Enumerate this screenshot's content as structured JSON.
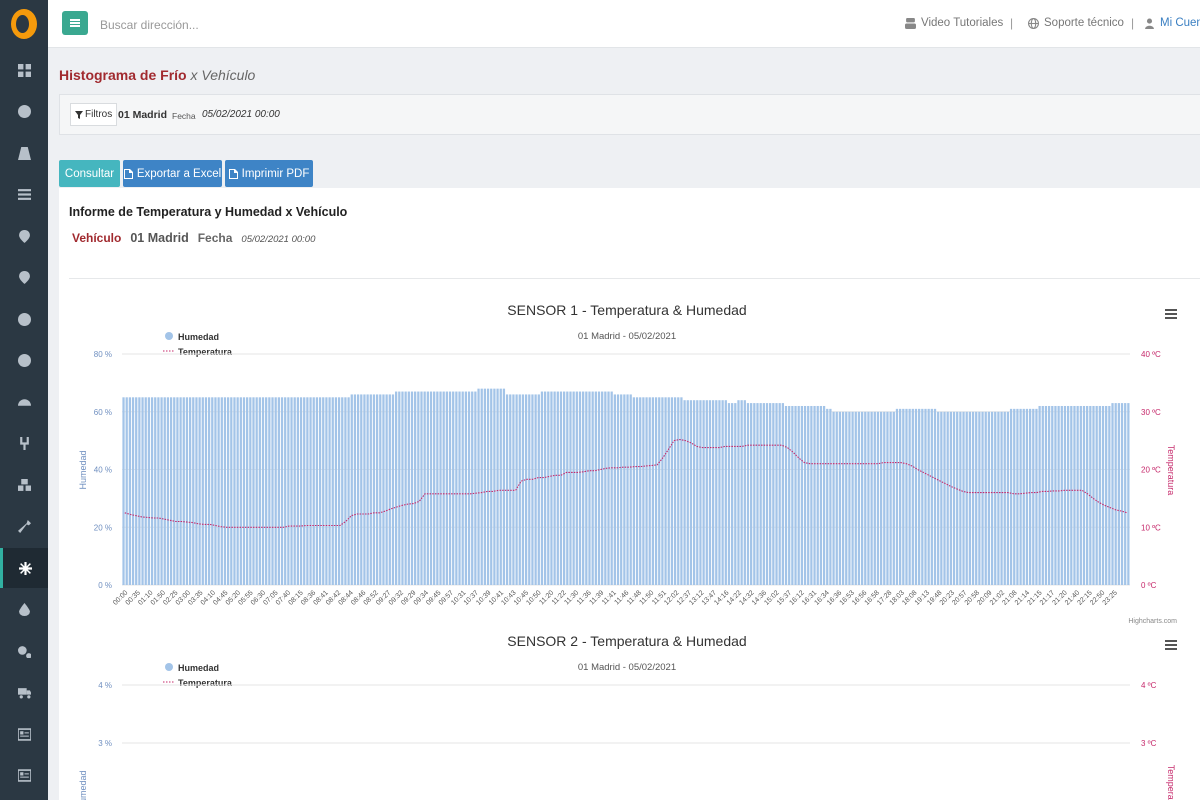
{
  "topbar": {
    "search_placeholder": "Buscar dirección...",
    "links": [
      {
        "label": "Video Tutoriales",
        "icon": "youtube-icon"
      },
      {
        "label": "Soporte técnico",
        "icon": "globe-icon"
      },
      {
        "label": "Mi Cuenta",
        "icon": "user-icon"
      }
    ],
    "separator": "|"
  },
  "sidebar": {
    "items": [
      {
        "name": "dashboard",
        "icon": "grid-icon"
      },
      {
        "name": "globe",
        "icon": "globe-icon"
      },
      {
        "name": "road",
        "icon": "road-icon"
      },
      {
        "name": "list",
        "icon": "list-icon"
      },
      {
        "name": "location",
        "icon": "map-pin-icon"
      },
      {
        "name": "location-2",
        "icon": "map-pin-icon"
      },
      {
        "name": "target",
        "icon": "target-icon"
      },
      {
        "name": "alert",
        "icon": "alert-icon"
      },
      {
        "name": "speed",
        "icon": "dashboard-icon"
      },
      {
        "name": "fork",
        "icon": "fork-icon"
      },
      {
        "name": "cubes",
        "icon": "cubes-icon"
      },
      {
        "name": "wrench",
        "icon": "wrench-icon"
      },
      {
        "name": "snowflake",
        "icon": "snowflake-icon",
        "active": true
      },
      {
        "name": "drop",
        "icon": "drop-icon"
      },
      {
        "name": "cogs",
        "icon": "cogs-icon"
      },
      {
        "name": "truck",
        "icon": "truck-icon"
      },
      {
        "name": "card",
        "icon": "id-card-icon"
      },
      {
        "name": "card-2",
        "icon": "id-card-icon"
      }
    ],
    "accent": "#31b0a1"
  },
  "page": {
    "title": "Histograma de Frío",
    "title_sub": "x Vehículo"
  },
  "filters": {
    "button_label": "Filtros",
    "vehicle": "01 Madrid",
    "date_label": "Fecha",
    "date": "05/02/2021 00:00"
  },
  "actions": {
    "consultar": "Consultar",
    "excel": "Exportar a Excel",
    "pdf": "Imprimir PDF"
  },
  "report": {
    "title": "Informe de Temperatura y Humedad x Vehículo",
    "vehicle_label": "Vehículo",
    "vehicle": "01 Madrid",
    "date_label": "Fecha",
    "date": "05/02/2021 00:00"
  },
  "chart_data": [
    {
      "type": "bar",
      "title": "SENSOR 1 - Temperatura & Humedad",
      "subtitle": "01 Madrid - 05/02/2021",
      "credits": "Highcharts.com",
      "legend_position": "top-left",
      "colors": {
        "humedad": "#a3c4e8",
        "temperatura": "#c6296b"
      },
      "ylabel_left": "Humedad",
      "ylabel_right": "Temperatura",
      "ylim_left": [
        0,
        80
      ],
      "ylim_right": [
        0,
        40
      ],
      "yticks_left": [
        "0 %",
        "20 %",
        "40 %",
        "60 %",
        "80 %"
      ],
      "yticks_right": [
        "0 ºC",
        "10 ºC",
        "20 ºC",
        "30 ºC",
        "40 ºC"
      ],
      "xtick_labels": [
        "00:00",
        "00:35",
        "01:10",
        "01:50",
        "02:25",
        "03:00",
        "03:35",
        "04:10",
        "04:45",
        "05:20",
        "05:55",
        "06:30",
        "07:05",
        "07:40",
        "08:15",
        "08:36",
        "08:41",
        "08:42",
        "08:44",
        "08:46",
        "08:52",
        "09:27",
        "09:32",
        "09:29",
        "09:34",
        "09:45",
        "09:57",
        "10:31",
        "10:37",
        "10:39",
        "10:41",
        "10:43",
        "10:45",
        "10:50",
        "11:20",
        "11:22",
        "11:30",
        "11:36",
        "11:39",
        "11:41",
        "11:46",
        "11:48",
        "11:50",
        "11:51",
        "12:02",
        "12:37",
        "13:12",
        "13:47",
        "14:16",
        "14:22",
        "14:32",
        "14:36",
        "15:02",
        "15:37",
        "16:12",
        "16:31",
        "16:34",
        "16:36",
        "16:53",
        "16:56",
        "16:58",
        "17:28",
        "18:03",
        "18:08",
        "19:13",
        "19:48",
        "20:23",
        "20:57",
        "20:58",
        "20:09",
        "21:02",
        "21:08",
        "21:14",
        "21:15",
        "21:17",
        "21:20",
        "21:40",
        "22:15",
        "22:50",
        "23:25"
      ],
      "series": [
        {
          "name": "Humedad",
          "type": "bar",
          "axis": "left",
          "values": [
            65,
            65,
            65,
            65,
            65,
            65,
            65,
            65,
            65,
            65,
            65,
            65,
            65,
            65,
            65,
            65,
            65,
            65,
            65,
            65,
            65,
            65,
            65,
            65,
            65,
            65,
            65,
            65,
            65,
            65,
            65,
            65,
            65,
            65,
            65,
            65,
            65,
            65,
            65,
            65,
            65,
            65,
            65,
            65,
            65,
            65,
            65,
            65,
            65,
            65,
            65,
            65,
            65,
            65,
            65,
            65,
            65,
            65,
            65,
            65,
            65,
            65,
            65,
            65,
            65,
            65,
            65,
            65,
            65,
            65,
            65,
            65,
            66,
            66,
            66,
            66,
            66,
            66,
            66,
            66,
            66,
            66,
            66,
            66,
            66,
            66,
            67,
            67,
            67,
            67,
            67,
            67,
            67,
            67,
            67,
            67,
            67,
            67,
            67,
            67,
            67,
            67,
            67,
            67,
            67,
            67,
            67,
            67,
            67,
            67,
            67,
            67,
            68,
            68,
            68,
            68,
            68,
            68,
            68,
            68,
            68,
            66,
            66,
            66,
            66,
            66,
            66,
            66,
            66,
            66,
            66,
            66,
            67,
            67,
            67,
            67,
            67,
            67,
            67,
            67,
            67,
            67,
            67,
            67,
            67,
            67,
            67,
            67,
            67,
            67,
            67,
            67,
            67,
            67,
            67,
            66,
            66,
            66,
            66,
            66,
            66,
            65,
            65,
            65,
            65,
            65,
            65,
            65,
            65,
            65,
            65,
            65,
            65,
            65,
            65,
            65,
            65,
            64,
            64,
            64,
            64,
            64,
            64,
            64,
            64,
            64,
            64,
            64,
            64,
            64,
            64,
            63,
            63,
            63,
            64,
            64,
            64,
            63,
            63,
            63,
            63,
            63,
            63,
            63,
            63,
            63,
            63,
            63,
            63,
            62,
            62,
            62,
            62,
            62,
            62,
            62,
            62,
            62,
            62,
            62,
            62,
            62,
            61,
            61,
            60,
            60,
            60,
            60,
            60,
            60,
            60,
            60,
            60,
            60,
            60,
            60,
            60,
            60,
            60,
            60,
            60,
            60,
            60,
            60,
            61,
            61,
            61,
            61,
            61,
            61,
            61,
            61,
            61,
            61,
            61,
            61,
            61,
            60,
            60,
            60,
            60,
            60,
            60,
            60,
            60,
            60,
            60,
            60,
            60,
            60,
            60,
            60,
            60,
            60,
            60,
            60,
            60,
            60,
            60,
            60,
            61,
            61,
            61,
            61,
            61,
            61,
            61,
            61,
            61,
            62,
            62,
            62,
            62,
            62,
            62,
            62,
            62,
            62,
            62,
            62,
            62,
            62,
            62,
            62,
            62,
            62,
            62,
            62,
            62,
            62,
            62,
            62,
            63,
            63,
            63,
            63,
            63,
            63
          ]
        },
        {
          "name": "Temperatura",
          "type": "line",
          "axis": "right",
          "values": [
            12.5,
            12.2,
            12.0,
            11.8,
            11.7,
            11.6,
            11.6,
            11.4,
            11.2,
            11.0,
            11.0,
            10.9,
            10.8,
            10.6,
            10.5,
            10.5,
            10.3,
            10.1,
            10.0,
            10.0,
            10.0,
            10.0,
            10.0,
            10.0,
            10.0,
            10.0,
            10.0,
            10.0,
            10.0,
            10.2,
            10.2,
            10.2,
            10.3,
            10.3,
            10.3,
            10.3,
            10.3,
            10.3,
            10.3,
            11.0,
            12.0,
            12.3,
            12.3,
            12.3,
            12.5,
            12.5,
            12.8,
            13.2,
            13.5,
            13.8,
            14.0,
            14.1,
            14.5,
            15.8,
            15.8,
            15.8,
            15.8,
            15.8,
            15.8,
            15.8,
            15.8,
            15.8,
            15.9,
            16.0,
            16.2,
            16.2,
            16.4,
            16.4,
            16.4,
            16.4,
            18.0,
            18.3,
            18.3,
            18.6,
            18.6,
            18.8,
            19.0,
            19.0,
            19.5,
            19.5,
            19.5,
            19.6,
            19.8,
            19.8,
            20.0,
            20.2,
            20.3,
            20.3,
            20.4,
            20.4,
            20.5,
            20.5,
            20.6,
            20.7,
            20.8,
            22.0,
            23.5,
            25.0,
            25.2,
            25.0,
            24.6,
            24.0,
            23.8,
            23.8,
            23.8,
            23.8,
            24.0,
            24.0,
            24.0,
            24.0,
            24.2,
            24.2,
            24.2,
            24.2,
            24.2,
            24.2,
            24.2,
            23.8,
            23.0,
            22.0,
            21.2,
            21.0,
            21.0,
            21.0,
            21.0,
            21.0,
            21.0,
            21.0,
            21.0,
            21.0,
            21.0,
            21.0,
            21.0,
            21.0,
            21.2,
            21.2,
            21.2,
            21.2,
            21.0,
            20.6,
            20.0,
            19.5,
            19.0,
            18.5,
            18.0,
            17.5,
            17.0,
            16.6,
            16.2,
            16.0,
            16.0,
            16.0,
            16.0,
            16.0,
            16.0,
            16.0,
            16.0,
            15.8,
            15.8,
            15.9,
            16.0,
            16.0,
            16.2,
            16.2,
            16.3,
            16.3,
            16.4,
            16.4,
            16.4,
            16.4,
            15.8,
            15.0,
            14.3,
            13.8,
            13.4,
            13.0,
            12.8,
            12.5
          ]
        }
      ]
    },
    {
      "type": "bar",
      "title": "SENSOR 2 - Temperatura & Humedad",
      "subtitle": "01 Madrid - 05/02/2021",
      "legend_position": "top-left",
      "colors": {
        "humedad": "#a3c4e8",
        "temperatura": "#c6296b"
      },
      "ylabel_left": "Humedad",
      "ylabel_right": "Temperatura",
      "yticks_left": [
        "3 %",
        "4 %"
      ],
      "yticks_right": [
        "3 ºC",
        "4 ºC"
      ],
      "series": [
        {
          "name": "Humedad",
          "type": "bar",
          "axis": "left",
          "values": []
        },
        {
          "name": "Temperatura",
          "type": "line",
          "axis": "right",
          "values": []
        }
      ]
    }
  ],
  "legend": {
    "humedad": "Humedad",
    "temperatura": "Temperatura"
  }
}
